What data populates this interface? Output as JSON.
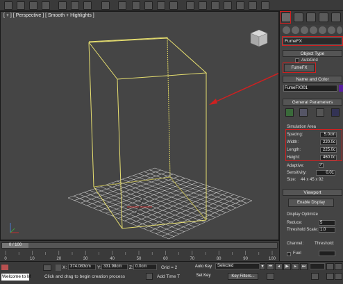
{
  "viewport": {
    "label": "[ + ] [ Perspective ] [ Smooth + Highlights ]"
  },
  "command_panel": {
    "object_type_dropdown": "FumeFX",
    "object_type_title": "Object Type",
    "autogrid_label": "AutoGrid",
    "fumefx_button": "FumeFX",
    "name_color_title": "Name and Color",
    "object_name": "FumeFX001",
    "object_color": "#5a1fa0",
    "general_params_title": "General Parameters",
    "simulation_area_label": "Simulation Area",
    "spacing_label": "Spacing:",
    "spacing_value": "5.0cm",
    "width_label": "Width:",
    "width_value": "220.0c",
    "length_label": "Length:",
    "length_value": "225.0c",
    "height_label": "Height:",
    "height_value": "460.0c",
    "adaptive_label": "Adaptive:",
    "sensitivity_label": "Sensitivity:",
    "sensitivity_value": "0.01",
    "size_label": "Size:",
    "size_value": "44 x 45 x 92",
    "viewport_title": "Viewport",
    "enable_display_label": "Enable Display",
    "display_optimize_label": "Display Optimize",
    "reduce_label": "Reduce:",
    "reduce_value": "5",
    "threshold_scale_label": "Threshold Scale:",
    "threshold_scale_value": "1.0",
    "channel_label": "Channel:",
    "threshold_label": "Threshold:",
    "fuel_label": "Fuel"
  },
  "timeline": {
    "frame_indicator": "0 / 100",
    "ticks": [
      "0",
      "10",
      "20",
      "30",
      "40",
      "50",
      "60",
      "70",
      "80",
      "90",
      "100"
    ]
  },
  "status": {
    "welcome_text": "Welcome to M",
    "prompt_text": "Click and drag to begin creation process",
    "x_label": "X:",
    "x_value": "374.083cm",
    "y_label": "Y:",
    "y_value": "331.98cm",
    "z_label": "Z:",
    "z_value": "0.0cm",
    "grid_text": "Grid = 2",
    "add_time_tag": "Add Time T",
    "auto_key": "Auto Key",
    "selected_option": "Selected",
    "set_key": "Set Key",
    "key_filters": "Key Filters..."
  },
  "colors": {
    "box_wire": "#e8e070",
    "grid_line": "#c8c8c8",
    "highlight_red": "#d02020"
  }
}
